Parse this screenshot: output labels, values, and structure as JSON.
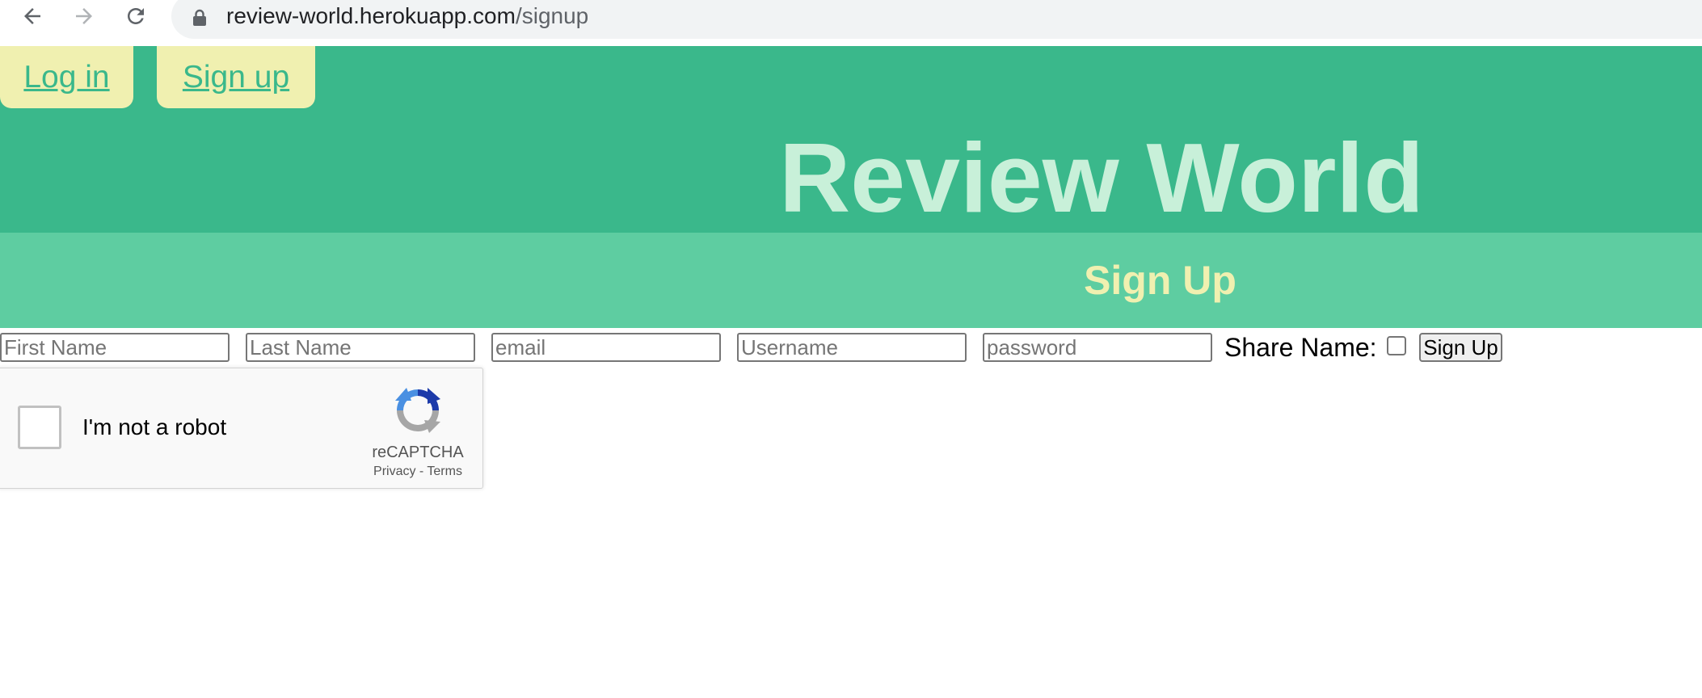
{
  "browser": {
    "url_host": "review-world.herokuapp.com",
    "url_path": "/signup",
    "icons": [
      "back-arrow-icon",
      "forward-arrow-icon",
      "reload-icon",
      "lock-icon"
    ]
  },
  "header": {
    "login_label": "Log in",
    "signup_label": "Sign up",
    "site_title": "Review World",
    "page_heading": "Sign Up"
  },
  "form": {
    "first_name_placeholder": "First Name",
    "last_name_placeholder": "Last Name",
    "email_placeholder": "email",
    "username_placeholder": "Username",
    "password_placeholder": "password",
    "share_name_label": "Share Name:",
    "submit_label": "Sign Up"
  },
  "captcha": {
    "label": "I'm not a robot",
    "brand": "reCAPTCHA",
    "privacy": "Privacy",
    "separator": " - ",
    "terms": "Terms"
  },
  "colors": {
    "header_bg": "#3ab88b",
    "subheader_bg": "#5ecda1",
    "title_color": "#c8f0d9",
    "heading_color": "#f0f0b0",
    "auth_button_bg": "#f0f0b0"
  }
}
